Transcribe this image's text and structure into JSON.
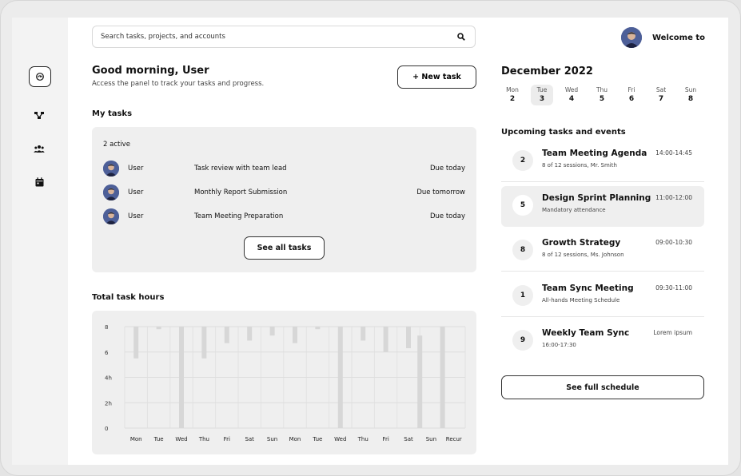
{
  "sidebar": {
    "items": [
      {
        "name": "dashboard-icon",
        "active": true
      },
      {
        "name": "projects-icon",
        "active": false
      },
      {
        "name": "team-icon",
        "active": false
      },
      {
        "name": "calendar-icon",
        "active": false
      }
    ]
  },
  "search": {
    "placeholder": "Search tasks, projects, and accounts"
  },
  "header": {
    "welcome": "Welcome to"
  },
  "greeting": {
    "title": "Good morning, User",
    "subtitle": "Access the panel to track your tasks and progress.",
    "new_task": "+ New task"
  },
  "my_tasks": {
    "title": "My tasks",
    "active": "2 active",
    "rows": [
      {
        "user": "User",
        "task": "Task review with team lead",
        "due": "Due today"
      },
      {
        "user": "User",
        "task": "Monthly Report Submission",
        "due": "Due tomorrow"
      },
      {
        "user": "User",
        "task": "Team Meeting Preparation",
        "due": "Due today"
      }
    ],
    "see_all": "See all tasks"
  },
  "hours": {
    "title": "Total task hours"
  },
  "chart_data": {
    "type": "bar",
    "title": "Total task hours",
    "xlabel": "",
    "ylabel": "",
    "y_ticks": [
      "8",
      "6",
      "4h",
      "2h",
      "0"
    ],
    "ylim": [
      0,
      8
    ],
    "grid": true,
    "categories": [
      "Mon",
      "Tue",
      "Wed",
      "Thu",
      "Fri",
      "Sat",
      "Sun",
      "Mon",
      "Tue",
      "Wed",
      "Thu",
      "Fri",
      "Sat",
      "Sun",
      "Recur"
    ],
    "floating_bars": [
      {
        "x": 0.5,
        "low": 5.5,
        "high": 8.0
      },
      {
        "x": 1.5,
        "low": 7.8,
        "high": 8.0
      },
      {
        "x": 2.5,
        "low": 0.0,
        "high": 8.0
      },
      {
        "x": 3.5,
        "low": 5.5,
        "high": 8.0
      },
      {
        "x": 4.5,
        "low": 6.7,
        "high": 8.0
      },
      {
        "x": 5.5,
        "low": 6.9,
        "high": 8.0
      },
      {
        "x": 6.5,
        "low": 7.3,
        "high": 8.0
      },
      {
        "x": 7.5,
        "low": 6.7,
        "high": 8.0
      },
      {
        "x": 8.5,
        "low": 7.8,
        "high": 8.0
      },
      {
        "x": 9.5,
        "low": 0.0,
        "high": 8.0
      },
      {
        "x": 10.5,
        "low": 6.9,
        "high": 8.0
      },
      {
        "x": 11.5,
        "low": 6.0,
        "high": 8.0
      },
      {
        "x": 12.5,
        "low": 6.3,
        "high": 8.0
      },
      {
        "x": 13.0,
        "low": 0.0,
        "high": 7.3
      },
      {
        "x": 14.0,
        "low": 0.0,
        "high": 8.0
      }
    ]
  },
  "calendar": {
    "title": "December 2022",
    "days": [
      {
        "name": "Mon",
        "date": "2",
        "selected": false
      },
      {
        "name": "Tue",
        "date": "3",
        "selected": true
      },
      {
        "name": "Wed",
        "date": "4",
        "selected": false
      },
      {
        "name": "Thu",
        "date": "5",
        "selected": false
      },
      {
        "name": "Fri",
        "date": "6",
        "selected": false
      },
      {
        "name": "Sat",
        "date": "7",
        "selected": false
      },
      {
        "name": "Sun",
        "date": "8",
        "selected": false
      }
    ]
  },
  "upcoming": {
    "title": "Upcoming tasks and events",
    "events": [
      {
        "num": "2",
        "title": "Team Meeting Agenda",
        "sub": "8 of 12 sessions, Mr. Smith",
        "time": "14:00-14:45",
        "highlight": false
      },
      {
        "num": "5",
        "title": "Design Sprint Planning",
        "sub": "Mandatory attendance",
        "time": "11:00-12:00",
        "highlight": true
      },
      {
        "num": "8",
        "title": "Growth Strategy",
        "sub": "8 of 12 sessions, Ms. Johnson",
        "time": "09:00-10:30",
        "highlight": false
      },
      {
        "num": "1",
        "title": "Team Sync Meeting",
        "sub": "All-hands Meeting Schedule",
        "time": "09:30-11:00",
        "highlight": false
      },
      {
        "num": "9",
        "title": "Weekly Team Sync",
        "sub": "16:00-17:30",
        "time": "Lorem ipsum",
        "highlight": false
      }
    ],
    "see_full": "See full schedule"
  },
  "colors": {
    "accent": "#111111",
    "card_bg": "#efefef",
    "bar": "#d7d7d7",
    "avatar": "#4d5f98"
  }
}
